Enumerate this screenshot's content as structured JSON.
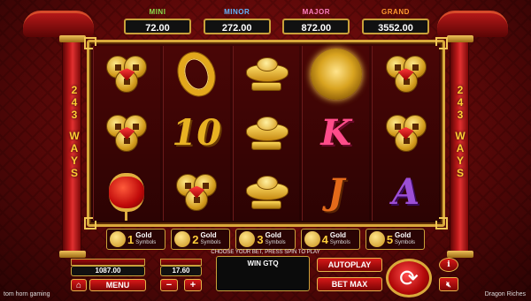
{
  "jackpots": [
    {
      "label": "MINI",
      "value": "72.00"
    },
    {
      "label": "MINOR",
      "value": "272.00"
    },
    {
      "label": "MAJOR",
      "value": "872.00"
    },
    {
      "label": "GRAND",
      "value": "3552.00"
    }
  ],
  "ways": "243 WAYS",
  "ways_lines": [
    "2",
    "4",
    "3",
    " ",
    "W",
    "A",
    "Y",
    "S"
  ],
  "reels": [
    [
      "coins-symbol",
      "coins-symbol",
      "lantern-symbol"
    ],
    [
      "gold-ring-symbol",
      "ten-symbol",
      "coins-symbol"
    ],
    [
      "gold-ingot-symbol",
      "gold-ingot-symbol",
      "gold-ingot-symbol"
    ],
    [
      "dragon-symbol",
      "k-symbol",
      "j-symbol"
    ],
    [
      "coins-symbol",
      "coins-symbol",
      "a-symbol"
    ]
  ],
  "symbol_text": {
    "ten": "10",
    "k": "K",
    "j": "J",
    "a": "A"
  },
  "gold_symbols": [
    {
      "count": "1",
      "label": "Gold",
      "sub": "Symbols"
    },
    {
      "count": "2",
      "label": "Gold",
      "sub": "Symbols"
    },
    {
      "count": "3",
      "label": "Gold",
      "sub": "Symbols"
    },
    {
      "count": "4",
      "label": "Gold",
      "sub": "Symbols"
    },
    {
      "count": "5",
      "label": "Gold",
      "sub": "Symbols"
    }
  ],
  "hint": "CHOOSE YOUR BET, PRESS SPIN TO PLAY",
  "balance": {
    "value": "1087.00"
  },
  "bet": {
    "value": "17.60"
  },
  "win_label": "WIN GTQ",
  "buttons": {
    "menu": "MENU",
    "minus": "−",
    "plus": "+",
    "autoplay": "AUTOPLAY",
    "betmax": "BET MAX",
    "info": "i",
    "home": "⌂",
    "sound": "🔇︎"
  },
  "footer": {
    "left": "tom horn gaming",
    "right": "Dragon Riches"
  }
}
